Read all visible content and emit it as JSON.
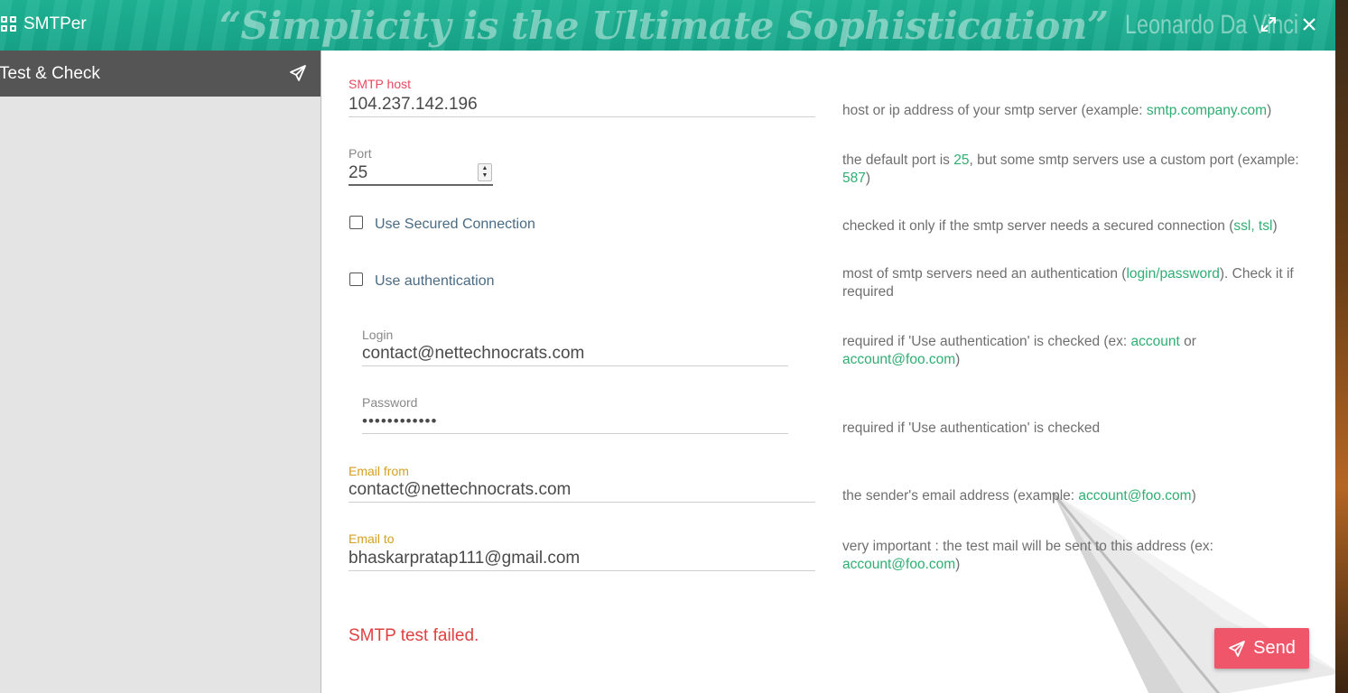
{
  "app": {
    "title": "SMTPer",
    "quote": "“Simplicity is the Ultimate Sophistication”",
    "quote_author": "Leonardo Da Vinci"
  },
  "sidebar": {
    "items": [
      {
        "label": "Test & Check",
        "icon": "send-icon"
      }
    ]
  },
  "form": {
    "smtp_host": {
      "label": "SMTP host",
      "value": "104.237.142.196"
    },
    "port": {
      "label": "Port",
      "value": "25"
    },
    "secured": {
      "label": "Use Secured Connection",
      "checked": false
    },
    "auth": {
      "label": "Use authentication",
      "checked": false
    },
    "login": {
      "label": "Login",
      "value": "contact@nettechnocrats.com"
    },
    "password": {
      "label": "Password",
      "value": "••••••••••••"
    },
    "email_from": {
      "label": "Email from",
      "value": "contact@nettechnocrats.com"
    },
    "email_to": {
      "label": "Email to",
      "value": "bhaskarpratap111@gmail.com"
    }
  },
  "help": {
    "host": {
      "pre": "host or ip address of your smtp server (example: ",
      "link": "smtp.company.com",
      "post": ")"
    },
    "port": {
      "pre": "the default port is ",
      "link1": "25",
      "mid": ", but some smtp servers use a custom port (example: ",
      "link2": "587",
      "post": ")"
    },
    "secured": {
      "pre": "checked it only if the smtp server needs a secured connection (",
      "link": "ssl, tsl",
      "post": ")"
    },
    "auth": {
      "pre": "most of smtp servers need an authentication (",
      "link": "login/password",
      "post": "). Check it if required"
    },
    "login": {
      "pre": "required if 'Use authentication' is checked (ex: ",
      "link1": "account",
      "mid": " or ",
      "link2": "account@foo.com",
      "post": ")"
    },
    "password": {
      "text": "required if 'Use authentication' is checked"
    },
    "from": {
      "pre": "the sender's email address (example: ",
      "link": "account@foo.com",
      "post": ")"
    },
    "to": {
      "pre": "very important : the test mail will be sent to this address (ex: ",
      "link": "account@foo.com",
      "post": ")"
    }
  },
  "status": {
    "error": "SMTP test failed."
  },
  "actions": {
    "send_label": "Send"
  },
  "colors": {
    "header": "#1fb495",
    "sidebar_active": "#555555",
    "accent_link": "#2fae72",
    "error": "#e04040",
    "send_button": "#f0566a"
  }
}
